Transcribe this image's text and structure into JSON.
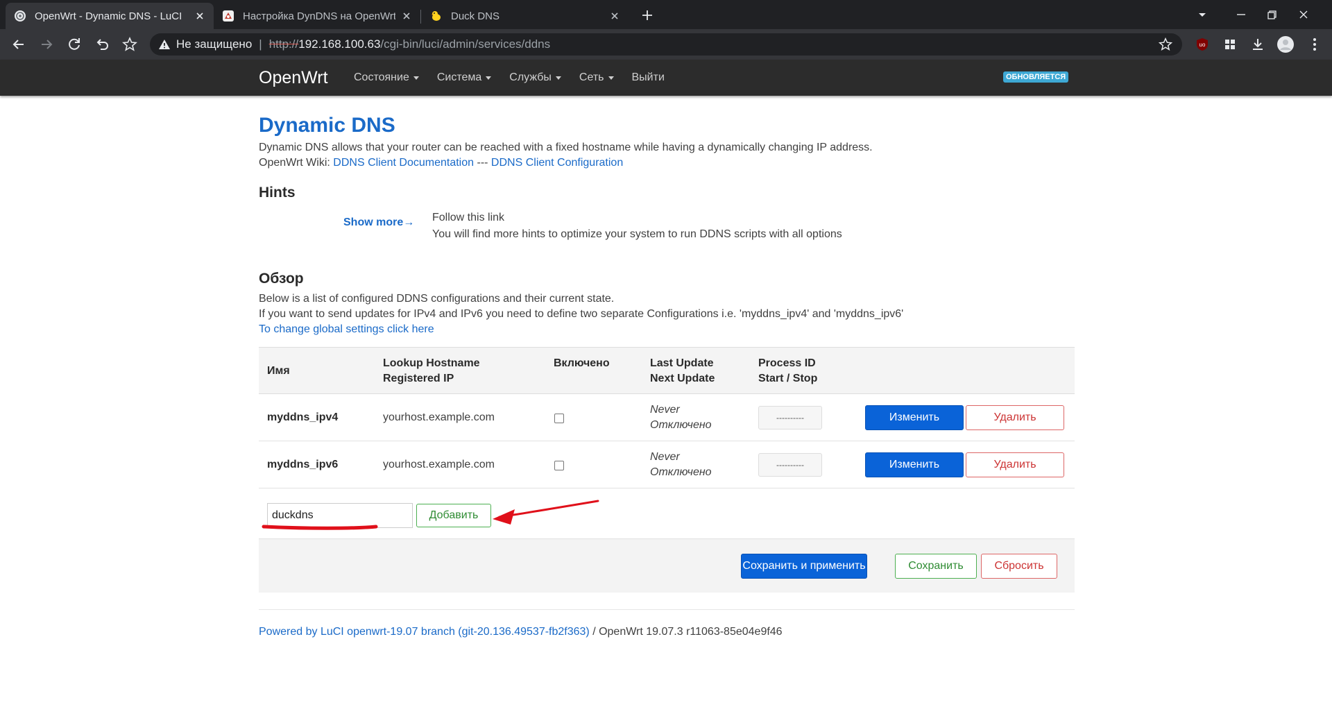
{
  "browser": {
    "tabs": [
      {
        "title": "OpenWrt - Dynamic DNS - LuCI",
        "icon": "globe-icon",
        "active": true
      },
      {
        "title": "Настройка DynDNS на OpenWrt",
        "icon": "site-favicon",
        "active": false
      },
      {
        "title": "Duck DNS",
        "icon": "duck-icon",
        "active": false
      }
    ],
    "security_label": "Не защищено",
    "url_scheme": "http://",
    "url_host": "192.168.100.63",
    "url_path": "/cgi-bin/luci/admin/services/ddns"
  },
  "navbar": {
    "brand": "OpenWrt",
    "menu": [
      {
        "label": "Состояние",
        "dropdown": true
      },
      {
        "label": "Система",
        "dropdown": true
      },
      {
        "label": "Службы",
        "dropdown": true
      },
      {
        "label": "Сеть",
        "dropdown": true
      },
      {
        "label": "Выйти",
        "dropdown": false
      }
    ],
    "badge": "ОБНОВЛЯЕТСЯ"
  },
  "page": {
    "title": "Dynamic DNS",
    "description": "Dynamic DNS allows that your router can be reached with a fixed hostname while having a dynamically changing IP address.",
    "wiki_prefix": "OpenWrt Wiki:",
    "wiki_link1": "DDNS Client Documentation",
    "wiki_sep": "---",
    "wiki_link2": "DDNS Client Configuration"
  },
  "hints": {
    "heading": "Hints",
    "show_more": "Show more→",
    "line1": "Follow this link",
    "line2": "You will find more hints to optimize your system to run DDNS scripts with all options"
  },
  "overview": {
    "heading": "Обзор",
    "line1": "Below is a list of configured DDNS configurations and their current state.",
    "line2": "If you want to send updates for IPv4 and IPv6 you need to define two separate Configurations i.e. 'myddns_ipv4' and 'myddns_ipv6'",
    "global_link": "To change global settings click here"
  },
  "table": {
    "headers": {
      "name": "Имя",
      "lookup1": "Lookup Hostname",
      "lookup2": "Registered IP",
      "enabled": "Включено",
      "update1": "Last Update",
      "update2": "Next Update",
      "pid1": "Process ID",
      "pid2": "Start / Stop"
    },
    "rows": [
      {
        "name": "myddns_ipv4",
        "hostname": "yourhost.example.com",
        "last": "Never",
        "next": "Отключено",
        "pid": "----------",
        "edit": "Изменить",
        "delete": "Удалить"
      },
      {
        "name": "myddns_ipv6",
        "hostname": "yourhost.example.com",
        "last": "Never",
        "next": "Отключено",
        "pid": "----------",
        "edit": "Изменить",
        "delete": "Удалить"
      }
    ]
  },
  "add": {
    "value": "duckdns",
    "button": "Добавить"
  },
  "actions": {
    "save_apply": "Сохранить и применить",
    "save": "Сохранить",
    "reset": "Сбросить"
  },
  "footer": {
    "link": "Powered by LuCI openwrt-19.07 branch (git-20.136.49537-fb2f363)",
    "rest": " / OpenWrt 19.07.3 r11063-85e04e9f46"
  },
  "colors": {
    "accent": "#1a6ac8",
    "primary_button": "#0a63d8",
    "annotation": "#e0101a"
  }
}
